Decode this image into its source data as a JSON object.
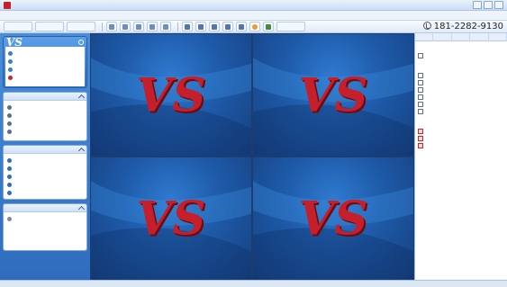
{
  "window": {
    "title": ""
  },
  "menu": {
    "items": [
      "",
      "",
      "",
      "",
      "",
      ""
    ]
  },
  "toolbar": {
    "buttons": [
      "",
      "",
      "",
      "",
      "",
      "",
      "",
      "",
      "",
      "",
      "",
      "",
      "",
      "",
      "",
      "",
      ""
    ],
    "phone": "181-2282-9130"
  },
  "sidebar": {
    "card": {
      "title": "",
      "links": [
        "",
        "",
        "",
        ""
      ]
    },
    "panels": [
      {
        "title": "",
        "items": [
          "",
          "",
          "",
          ""
        ]
      },
      {
        "title": "",
        "items": [
          "",
          "",
          "",
          "",
          ""
        ]
      },
      {
        "title": "",
        "items": [
          "",
          "",
          "",
          ""
        ]
      }
    ]
  },
  "viewgrid": {
    "tiles": 4,
    "logo_text": "VS",
    "logo_color": "#c41f2a"
  },
  "rightpanel": {
    "tabs": [
      "",
      "",
      "",
      "",
      ""
    ],
    "sections": [
      {
        "title": "",
        "nodes": [
          ""
        ]
      },
      {
        "title": "",
        "nodes": [
          "",
          "",
          "",
          "",
          "",
          ""
        ]
      },
      {
        "title": "",
        "rows": [
          {
            "label": "",
            "v1": "",
            "v2": ""
          },
          {
            "label": "",
            "v1": "",
            "v2": ""
          },
          {
            "label": "",
            "v1": "",
            "v2": ""
          }
        ]
      }
    ]
  },
  "status": {
    "left": "",
    "right": ""
  },
  "colors": {
    "accent": "#2f6cbd",
    "brand_red": "#c41f2a"
  }
}
